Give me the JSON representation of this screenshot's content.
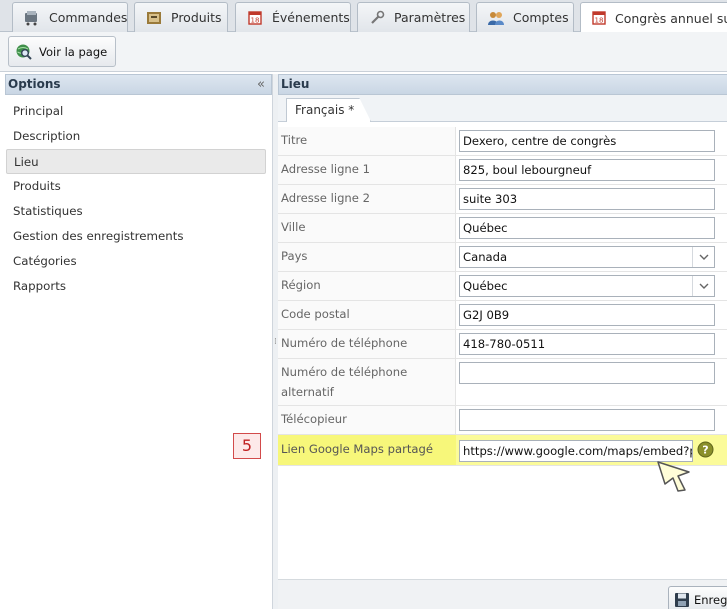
{
  "tabs": [
    {
      "label": "Commandes",
      "icon": "cart-icon"
    },
    {
      "label": "Produits",
      "icon": "box-icon"
    },
    {
      "label": "Événements",
      "icon": "calendar-icon"
    },
    {
      "label": "Paramètres",
      "icon": "wrench-icon"
    },
    {
      "label": "Comptes",
      "icon": "users-icon"
    },
    {
      "label": "Congrès annuel sur le",
      "icon": "calendar-icon"
    }
  ],
  "toolbar": {
    "view_page_label": "Voir la page"
  },
  "options_panel": {
    "title": "Options",
    "collapse_glyph": "«",
    "items": [
      "Principal",
      "Description",
      "Lieu",
      "Produits",
      "Statistiques",
      "Gestion des enregistrements",
      "Catégories",
      "Rapports"
    ],
    "active": "Lieu"
  },
  "lieu_panel": {
    "title": "Lieu",
    "language_tab": "Français *"
  },
  "form": {
    "titre": {
      "label": "Titre",
      "value": "Dexero, centre de congrès"
    },
    "adresse1": {
      "label": "Adresse ligne 1",
      "value": "825, boul lebourgneuf"
    },
    "adresse2": {
      "label": "Adresse ligne 2",
      "value": "suite 303"
    },
    "ville": {
      "label": "Ville",
      "value": "Québec"
    },
    "pays": {
      "label": "Pays",
      "value": "Canada"
    },
    "region": {
      "label": "Région",
      "value": "Québec"
    },
    "code_postal": {
      "label": "Code postal",
      "value": "G2J 0B9"
    },
    "telephone": {
      "label": "Numéro de téléphone",
      "value": "418-780-0511"
    },
    "telephone_alt": {
      "label_line1": "Numéro de téléphone",
      "label_line2": "alternatif",
      "value": ""
    },
    "telecopieur": {
      "label": "Télécopieur",
      "value": ""
    },
    "google_maps": {
      "label": "Lien Google Maps partagé",
      "value": "https://www.google.com/maps/embed?pb"
    }
  },
  "annotation": {
    "step_number": "5"
  },
  "savebar": {
    "save_label": "Enregistrer"
  },
  "colors": {
    "highlight": "#fbfb9a",
    "step_border": "#d24a4a",
    "header_bg": "#c9d6e4"
  }
}
